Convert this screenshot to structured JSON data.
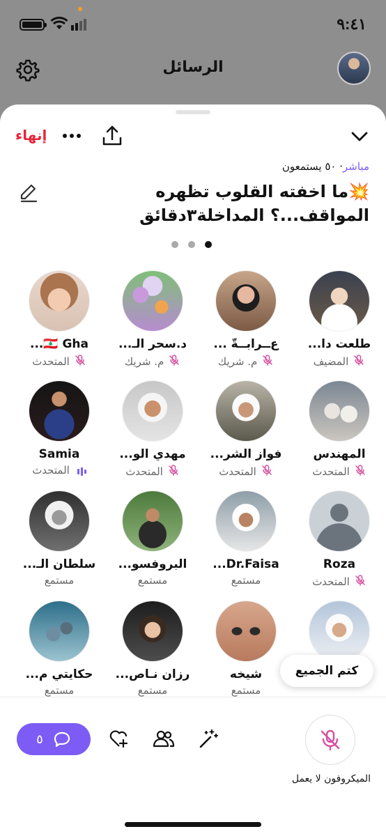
{
  "status_bar": {
    "time": "٩:٤١"
  },
  "header": {
    "title": "الرسائل"
  },
  "sheet": {
    "end_label": "إنهاء",
    "live_label": "مباشر",
    "listeners_label": "· ٥٠ يستمعون",
    "title": "💥ما اخفته القلوب تظهره المواقف...؟ المداخلة٣دقائق",
    "pager": {
      "pages": 3,
      "active": 1
    }
  },
  "participants": [
    {
      "name": "طلعت دا...",
      "role": "المضيف",
      "status": "mic-off"
    },
    {
      "name": "ﻉــراﺑــةّ ...",
      "role": "م. شريك",
      "status": "mic-off"
    },
    {
      "name": "د.سحر الـ...",
      "role": "م. شريك",
      "status": "mic-off"
    },
    {
      "name": "🇱🇧 Gha...",
      "role": "المتحدث",
      "status": "mic-off"
    },
    {
      "name": "المهندس",
      "role": "المتحدث",
      "status": "mic-off"
    },
    {
      "name": "فواز الشر...",
      "role": "المتحدث",
      "status": "mic-off"
    },
    {
      "name": "مهدي الو...",
      "role": "المتحدث",
      "status": "mic-off"
    },
    {
      "name": "Samia",
      "role": "المتحدث",
      "status": "speaking"
    },
    {
      "name": "Roza",
      "role": "المتحدث",
      "status": "mic-off"
    },
    {
      "name": "Dr.Faisa...",
      "role": "مستمع",
      "status": "none"
    },
    {
      "name": "البروفسو...",
      "role": "مستمع",
      "status": "none"
    },
    {
      "name": "سلطان الـ...",
      "role": "مستمع",
      "status": "none"
    },
    {
      "name": "",
      "role": "مستمع",
      "status": "none"
    },
    {
      "name": "شيخه",
      "role": "مستمع",
      "status": "none"
    },
    {
      "name": "رزان نـاص...",
      "role": "مستمع",
      "status": "none"
    },
    {
      "name": "حكايتي م...",
      "role": "مستمع",
      "status": "none"
    }
  ],
  "mute_all_label": "كتم الجميع",
  "bottom_bar": {
    "chat_count": "٥",
    "mic_caption": "الميكروفون لا يعمل"
  },
  "colors": {
    "accent": "#7c5cf5",
    "danger": "#e5273b",
    "mic_off": "#d64fa0"
  }
}
